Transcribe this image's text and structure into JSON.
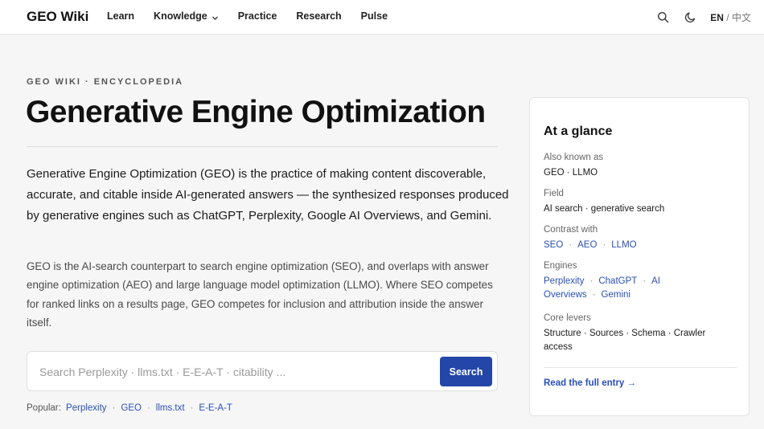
{
  "topbar": {
    "brand": "GEO Wiki",
    "nav": [
      {
        "label": "Learn"
      },
      {
        "label": "Knowledge"
      },
      {
        "label": "Practice"
      },
      {
        "label": "Research"
      },
      {
        "label": "Pulse"
      }
    ],
    "icons": [
      "search-icon",
      "moon-icon"
    ],
    "lang_current": "EN",
    "lang_sep": " / ",
    "lang_alt": "中文"
  },
  "article": {
    "eyebrow": "GEO WIKI · ENCYCLOPEDIA",
    "title": "Generative Engine Optimization",
    "lead": "Generative Engine Optimization (GEO) is the practice of making content discoverable, accurate, and citable inside AI-generated answers — the synthesized responses produced by generative engines such as ChatGPT, Perplexity, Google AI Overviews, and Gemini.",
    "body": "GEO is the AI-search counterpart to search engine optimization (SEO), and overlaps with answer engine optimization (AEO) and large language model optimization (LLMO). Where SEO competes for ranked links on a results page, GEO competes for inclusion and attribution inside the answer itself."
  },
  "search": {
    "placeholder": "Search Perplexity · llms.txt · E-E-A-T · citability ...",
    "value": "",
    "button": "Search",
    "popular_label": "Popular:",
    "popular": [
      "Perplexity",
      "GEO",
      "llms.txt",
      "E-E-A-T"
    ]
  },
  "glance": {
    "title": "At a glance",
    "aka_label": "Also known as",
    "aka_value": "GEO · LLMO",
    "field_label": "Field",
    "field_value": "AI search · generative search",
    "contrast_label": "Contrast with",
    "contrast": [
      "SEO",
      "AEO",
      "LLMO"
    ],
    "engines_label": "Engines",
    "engines": [
      "Perplexity",
      "ChatGPT",
      "AI Overviews",
      "Gemini"
    ],
    "levers_label": "Core levers",
    "levers_value": "Structure · Sources · Schema · Crawler access",
    "cta": "Read the full entry →"
  },
  "colors": {
    "accent": "#2346a8",
    "link": "#2a4fb8",
    "background": "#f6f6f6"
  }
}
